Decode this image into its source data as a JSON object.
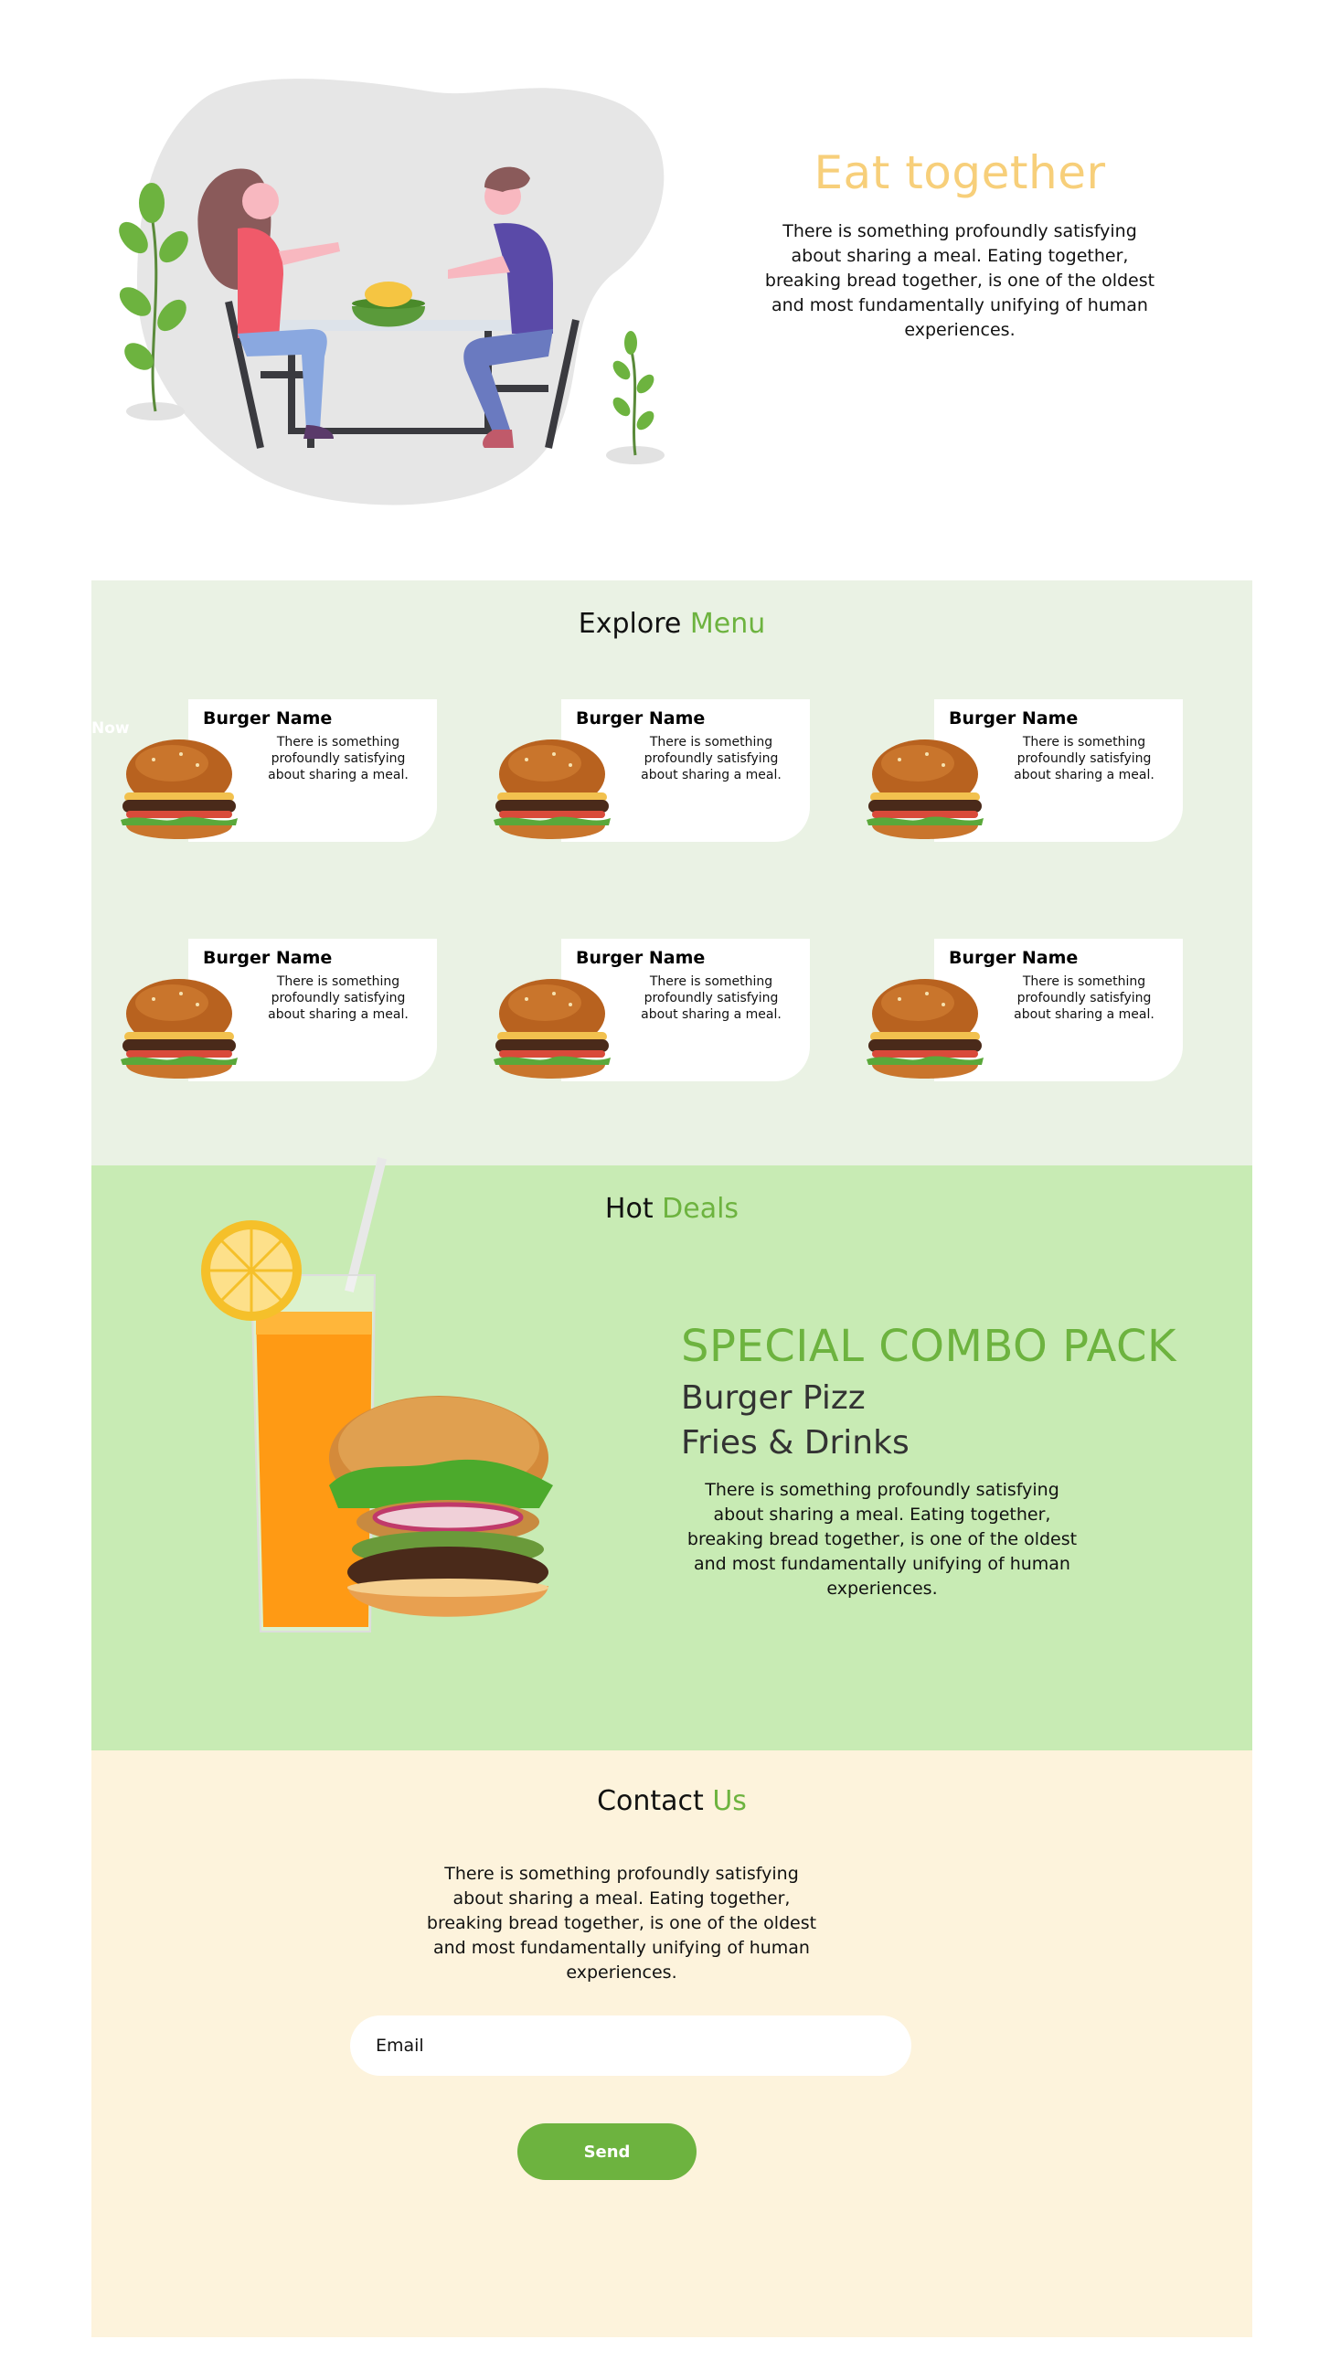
{
  "hero": {
    "title": "Eat together",
    "description": "There is something profoundly satisfying about sharing a meal. Eating together, breaking bread together, is one of the oldest and most fundamentally unifying of human experiences."
  },
  "menu": {
    "heading_main": "Explore",
    "heading_accent": "Menu",
    "now_label": "Now",
    "items": [
      {
        "name": "Burger Name",
        "description": "There is something profoundly satisfying about sharing a meal."
      },
      {
        "name": "Burger Name",
        "description": "There is something profoundly satisfying about sharing a meal."
      },
      {
        "name": "Burger Name",
        "description": "There is something profoundly satisfying about sharing a meal."
      },
      {
        "name": "Burger Name",
        "description": "There is something profoundly satisfying about sharing a meal."
      },
      {
        "name": "Burger Name",
        "description": "There is something profoundly satisfying about sharing a meal."
      },
      {
        "name": "Burger Name",
        "description": "There is something profoundly satisfying about sharing a meal."
      }
    ]
  },
  "deals": {
    "heading_main": "Hot",
    "heading_accent": "Deals",
    "combo_title": "SPECIAL COMBO PACK",
    "line1": "Burger Pizz",
    "line2": "Fries & Drinks",
    "description": "There is something profoundly satisfying about sharing a meal. Eating together, breaking bread together, is one of the oldest and most fundamentally unifying of human experiences."
  },
  "contact": {
    "heading_main": "Contact",
    "heading_accent": "Us",
    "description": "There is something profoundly satisfying about sharing a meal. Eating together, breaking bread together, is one of the oldest and most fundamentally unifying of human experiences.",
    "email_placeholder": "Email",
    "send_label": "Send"
  },
  "colors": {
    "accent_green": "#6db33f",
    "hero_title": "#f7cf7a",
    "menu_bg": "#eaf2e4",
    "deals_bg": "#c8ebb4",
    "contact_bg": "#fdf3dc"
  },
  "icons": {
    "hero": "people-eating-illustration",
    "menu_item": "burger-image",
    "deals": "burger-and-juice-image"
  }
}
